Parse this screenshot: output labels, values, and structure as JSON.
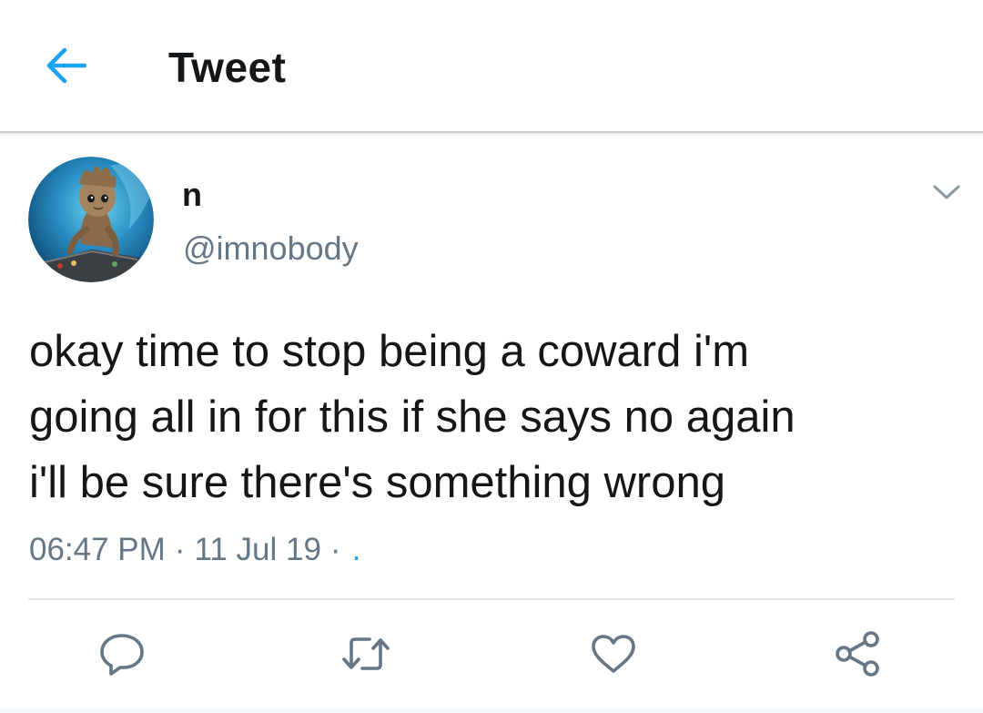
{
  "header": {
    "title": "Tweet",
    "back_icon": "arrow-left-icon"
  },
  "author": {
    "display_name": "n",
    "handle": "@imnobody",
    "avatar_icon": "avatar"
  },
  "tweet": {
    "text": "okay time to stop being a coward i'm\ngoing all in for this if she says no again\ni'll be sure there's something wrong",
    "time": "06:47 PM",
    "date": "11 Jul 19",
    "separator": "·",
    "source": "."
  },
  "actions": {
    "reply_icon": "reply-icon",
    "retweet_icon": "retweet-icon",
    "like_icon": "heart-icon",
    "share_icon": "share-icon"
  },
  "colors": {
    "accent": "#1da1f2",
    "text": "#14171a",
    "muted": "#657786",
    "icon": "#657786",
    "divider": "#e1e8ed"
  }
}
